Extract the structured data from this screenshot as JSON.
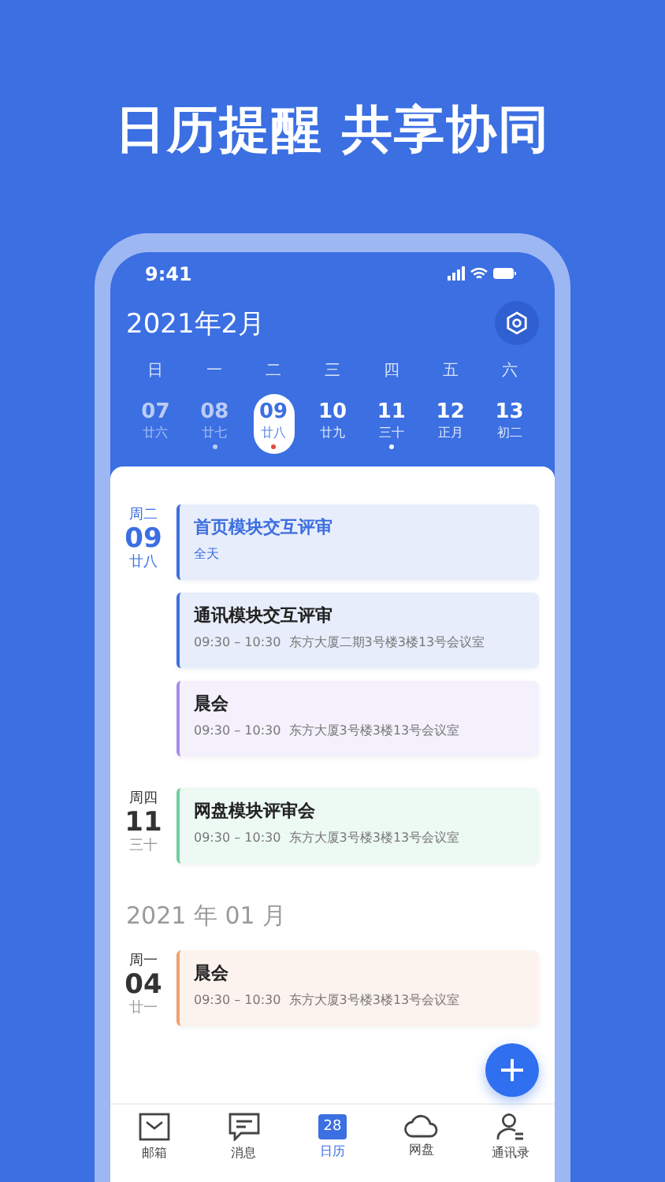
{
  "headline": "日历提醒 共享协同",
  "status_bar": {
    "time": "9:41"
  },
  "calendar": {
    "month_title": "2021年2月",
    "weekdays": [
      "日",
      "一",
      "二",
      "三",
      "四",
      "五",
      "六"
    ],
    "days": [
      {
        "day": "07",
        "lunar": "廿六",
        "past": true,
        "selected": false,
        "has_event": false
      },
      {
        "day": "08",
        "lunar": "廿七",
        "past": true,
        "selected": false,
        "has_event": true
      },
      {
        "day": "09",
        "lunar": "廿八",
        "past": false,
        "selected": true,
        "has_event": true
      },
      {
        "day": "10",
        "lunar": "廿九",
        "past": false,
        "selected": false,
        "has_event": false
      },
      {
        "day": "11",
        "lunar": "三十",
        "past": false,
        "selected": false,
        "has_event": true
      },
      {
        "day": "12",
        "lunar": "正月",
        "past": false,
        "selected": false,
        "has_event": false
      },
      {
        "day": "13",
        "lunar": "初二",
        "past": false,
        "selected": false,
        "has_event": false
      }
    ]
  },
  "agenda": [
    {
      "kind": "group",
      "weekday": "周二",
      "day": "09",
      "lunar": "廿八",
      "today": true,
      "events": [
        {
          "kind": "allday",
          "title": "首页模块交互评审",
          "subtitle": "全天",
          "color": "#3d6fe0"
        },
        {
          "kind": "timed",
          "title": "通讯模块交互评审",
          "time": "09:30 – 10:30",
          "location": "东方大厦二期3号楼3楼13号会议室",
          "color": "#3d6fe0"
        },
        {
          "kind": "timed",
          "title": "晨会",
          "time": "09:30 – 10:30",
          "location": "东方大厦3号楼3楼13号会议室",
          "color": "#a78bea"
        }
      ]
    },
    {
      "kind": "group",
      "weekday": "周四",
      "day": "11",
      "lunar": "三十",
      "today": false,
      "events": [
        {
          "kind": "timed",
          "title": "网盘模块评审会",
          "time": "09:30 – 10:30",
          "location": "东方大厦3号楼3楼13号会议室",
          "color": "#6fcf9f"
        }
      ]
    },
    {
      "kind": "month",
      "title": "2021 年 01 月"
    },
    {
      "kind": "group",
      "weekday": "周一",
      "day": "04",
      "lunar": "廿一",
      "today": false,
      "events": [
        {
          "kind": "timed",
          "title": "晨会",
          "time": "09:30 – 10:30",
          "location": "东方大厦3号楼3楼13号会议室",
          "color": "#f0a070"
        }
      ]
    }
  ],
  "nav": [
    {
      "kind": "mail",
      "label": "邮箱",
      "selected": false
    },
    {
      "kind": "message",
      "label": "消息",
      "selected": false
    },
    {
      "kind": "calendar",
      "label": "日历",
      "badge": "28",
      "selected": true
    },
    {
      "kind": "cloud",
      "label": "网盘",
      "selected": false
    },
    {
      "kind": "contacts",
      "label": "通讯录",
      "selected": false
    }
  ]
}
